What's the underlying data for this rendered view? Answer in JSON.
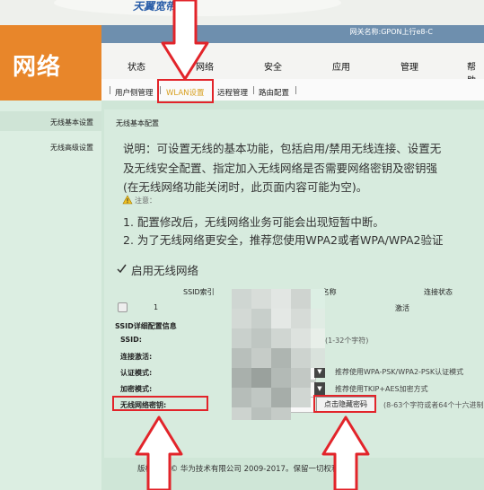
{
  "banner": {
    "brand_text": "天翼宽带"
  },
  "section": {
    "title": "网络"
  },
  "gateway": {
    "name": "网关名称:GPON上行e8-C"
  },
  "nav": {
    "items": [
      {
        "label": "状态"
      },
      {
        "label": "网络"
      },
      {
        "label": "安全"
      },
      {
        "label": "应用"
      },
      {
        "label": "管理"
      },
      {
        "label": "帮助"
      }
    ]
  },
  "subnav": {
    "items": [
      {
        "label": "用户侧管理"
      },
      {
        "label": "WLAN设置"
      },
      {
        "label": "远程管理"
      },
      {
        "label": "路由配置"
      }
    ]
  },
  "sidebar": {
    "items": [
      {
        "label": "无线基本设置"
      },
      {
        "label": "无线高级设置"
      }
    ]
  },
  "content": {
    "heading": "无线基本配置",
    "desc_lines": [
      "说明：可设置无线的基本功能，包括启用/禁用无线连接、设置无",
      "及无线安全配置、指定加入无线网络是否需要网络密钥及密钥强",
      "(在无线网络功能关闭时，此页面内容可能为空)。"
    ],
    "note_label": "注意：",
    "note_lines": [
      "1. 配置修改后，无线网络业务可能会出现短暂中断。",
      "2. 为了无线网络更安全，推荐您使用WPA2或者WPA/WPA2验证"
    ],
    "enable_label": "启用无线网络",
    "table_headers": {
      "index": "SSID索引",
      "name": "SSID名称",
      "status": "连接状态"
    },
    "table_row": {
      "index": "1",
      "status": "激活"
    },
    "detail_heading": "SSID详细配置信息",
    "fields": {
      "ssid": "SSID:",
      "ssid_hint": "(1-32个字符)",
      "activate": "连接激活:",
      "auth_mode": "认证模式:",
      "auth_hint": "推荐使用WPA-PSK/WPA2-PSK认证模式",
      "encrypt_mode": "加密模式:",
      "encrypt_hint": "推荐使用TKIP+AES加密方式",
      "key_label": "无线网络密钥:",
      "key_hint": "(8-63个字符或者64个十六进制",
      "toggle_button": "点击隐藏密码"
    }
  },
  "footer": {
    "copyright": "版权所有 © 华为技术有限公司 2009-2017。保留一切权利。"
  },
  "colors": {
    "annotation_red": "#e2242a",
    "section_orange": "#e8862a",
    "gateway_bar": "#6e8fae"
  }
}
